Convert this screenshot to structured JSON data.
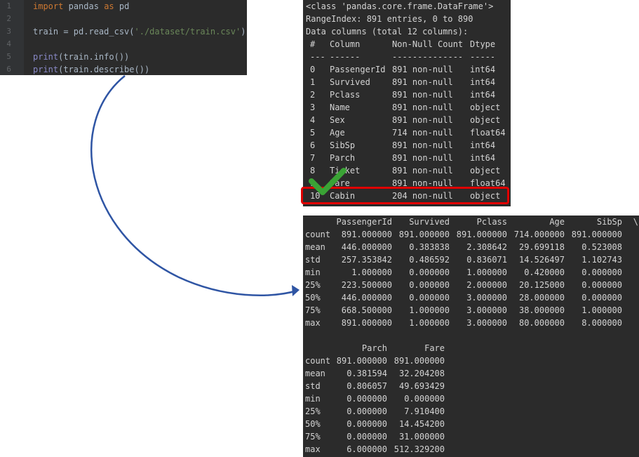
{
  "editor": {
    "lines": [
      {
        "num": "1",
        "tokens": [
          [
            "kw",
            "import"
          ],
          [
            "",
            "pandas"
          ],
          [
            "kw",
            "as"
          ],
          [
            "",
            "pd"
          ]
        ]
      },
      {
        "num": "2",
        "tokens": []
      },
      {
        "num": "3",
        "tokens": [
          [
            "",
            "train = pd.read_csv("
          ],
          [
            "str",
            "'./dataset/train.csv'"
          ],
          [
            "",
            ")"
          ]
        ]
      },
      {
        "num": "4",
        "tokens": []
      },
      {
        "num": "5",
        "tokens": [
          [
            "fn",
            "print"
          ],
          [
            "",
            "(train.info())"
          ]
        ]
      },
      {
        "num": "6",
        "tokens": [
          [
            "fn",
            "print"
          ],
          [
            "",
            "(train.describe())"
          ]
        ]
      }
    ]
  },
  "info_output": {
    "header_lines": [
      "<class 'pandas.core.frame.DataFrame'>",
      "RangeIndex: 891 entries, 0 to 890",
      "Data columns (total 12 columns):"
    ],
    "columns": [
      "#",
      "Column",
      "Non-Null Count",
      "Dtype"
    ],
    "separators": [
      "---",
      "------",
      "--------------",
      "-----"
    ],
    "rows": [
      [
        "0",
        "PassengerId",
        "891 non-null",
        "int64"
      ],
      [
        "1",
        "Survived",
        "891 non-null",
        "int64"
      ],
      [
        "2",
        "Pclass",
        "891 non-null",
        "int64"
      ],
      [
        "3",
        "Name",
        "891 non-null",
        "object"
      ],
      [
        "4",
        "Sex",
        "891 non-null",
        "object"
      ],
      [
        "5",
        "Age",
        "714 non-null",
        "float64"
      ],
      [
        "6",
        "SibSp",
        "891 non-null",
        "int64"
      ],
      [
        "7",
        "Parch",
        "891 non-null",
        "int64"
      ],
      [
        "8",
        "Ticket",
        "891 non-null",
        "object"
      ],
      [
        "9",
        "Fare",
        "891 non-null",
        "float64"
      ],
      [
        "10",
        "Cabin",
        "204 non-null",
        "object"
      ]
    ],
    "highlighted_row": "10"
  },
  "describe_output": {
    "table1": {
      "columns": [
        "PassengerId",
        "Survived",
        "Pclass",
        "Age",
        "SibSp",
        "\\"
      ],
      "rows": [
        [
          "count",
          "891.000000",
          "891.000000",
          "891.000000",
          "714.000000",
          "891.000000"
        ],
        [
          "mean",
          "446.000000",
          "0.383838",
          "2.308642",
          "29.699118",
          "0.523008"
        ],
        [
          "std",
          "257.353842",
          "0.486592",
          "0.836071",
          "14.526497",
          "1.102743"
        ],
        [
          "min",
          "1.000000",
          "0.000000",
          "1.000000",
          "0.420000",
          "0.000000"
        ],
        [
          "25%",
          "223.500000",
          "0.000000",
          "2.000000",
          "20.125000",
          "0.000000"
        ],
        [
          "50%",
          "446.000000",
          "0.000000",
          "3.000000",
          "28.000000",
          "0.000000"
        ],
        [
          "75%",
          "668.500000",
          "1.000000",
          "3.000000",
          "38.000000",
          "1.000000"
        ],
        [
          "max",
          "891.000000",
          "1.000000",
          "3.000000",
          "80.000000",
          "8.000000"
        ]
      ]
    },
    "table2": {
      "columns": [
        "Parch",
        "Fare"
      ],
      "rows": [
        [
          "count",
          "891.000000",
          "891.000000"
        ],
        [
          "mean",
          "0.381594",
          "32.204208"
        ],
        [
          "std",
          "0.806057",
          "49.693429"
        ],
        [
          "min",
          "0.000000",
          "0.000000"
        ],
        [
          "25%",
          "0.000000",
          "7.910400"
        ],
        [
          "50%",
          "0.000000",
          "14.454200"
        ],
        [
          "75%",
          "0.000000",
          "31.000000"
        ],
        [
          "max",
          "6.000000",
          "512.329200"
        ]
      ]
    }
  },
  "annotations": {
    "arrow_color": "#2f55a4",
    "check_color": "#3aa335",
    "highlight_color": "#e00000",
    "check_icon": "checkmark-icon",
    "arrow_icon": "curved-arrow-icon"
  }
}
